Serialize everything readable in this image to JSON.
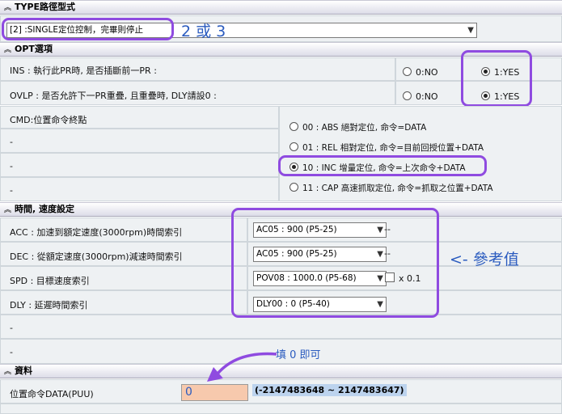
{
  "type_section": {
    "title": "TYPE路徑型式",
    "select_value": "[2] :SINGLE定位控制，完畢則停止",
    "note": "2 或 3"
  },
  "opt_section": {
    "title": "OPT選項",
    "ins_label": "INS : 執行此PR時, 是否插斷前一PR :",
    "ovlp_label": "OVLP : 是否允許下一PR重疊, 且重疊時, DLY請設0 :",
    "no_label": "0:NO",
    "yes_label": "1:YES",
    "cmd_label": "CMD:位置命令終點",
    "dash": "-",
    "cmd_options": [
      "00 : ABS 絕對定位, 命令=DATA",
      "01 : REL 相對定位, 命令=目前回授位置+DATA",
      "10 : INC 增量定位, 命令=上次命令+DATA",
      "11 : CAP 高速抓取定位, 命令=抓取之位置+DATA"
    ]
  },
  "speed_section": {
    "title": "時間, 速度設定",
    "acc_label": "ACC : 加速到額定速度(3000rpm)時間索引",
    "dec_label": "DEC : 從額定速度(3000rpm)減速時間索引",
    "spd_label": "SPD : 目標速度索引",
    "dly_label": "DLY : 延遲時間索引",
    "acc_value": "AC05 : 900 (P5-25)",
    "dec_value": "AC05 : 900 (P5-25)",
    "spd_value": "POV08 : 1000.0 (P5-68)",
    "dly_value": "DLY00 : 0 (P5-40)",
    "suffix": "--",
    "scale_label": "x 0.1",
    "note": "<- 參考值",
    "dash": "-",
    "fill_note": "填 0 即可"
  },
  "data_section": {
    "title": "資料",
    "pos_label": "位置命令DATA(PUU)",
    "pos_value": "0",
    "range": "(-2147483648 ~ 2147483647)"
  },
  "colors": {
    "annotation": "#8f4be0",
    "note_text": "#2a5bbf",
    "input_bg": "#f7c9ad",
    "range_bg": "#bcd3ee"
  }
}
